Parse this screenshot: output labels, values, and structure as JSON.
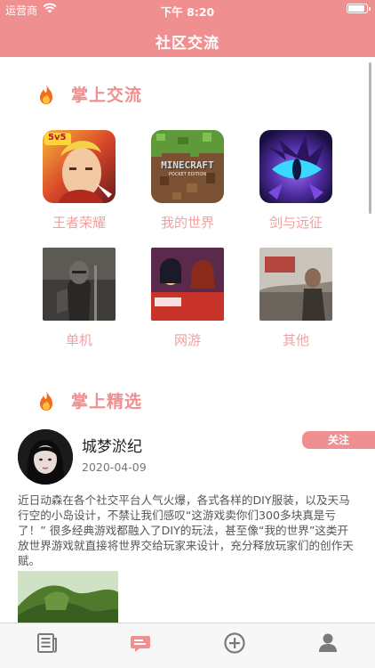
{
  "status_bar": {
    "carrier": "运营商",
    "time": "下午 8:20"
  },
  "nav": {
    "title": "社区交流"
  },
  "sections": {
    "exchange": {
      "title": "掌上交流",
      "icon": "flame-icon"
    },
    "featured": {
      "title": "掌上精选",
      "icon": "flame-icon"
    }
  },
  "categories": [
    {
      "label": "王者荣耀",
      "badge": "5v5"
    },
    {
      "label": "我的世界",
      "logo": "MINECRAFT",
      "logo_sub": "POCKET EDITION"
    },
    {
      "label": "剑与远征"
    },
    {
      "label": "单机"
    },
    {
      "label": "网游"
    },
    {
      "label": "其他"
    }
  ],
  "post": {
    "author": "城梦淤纪",
    "date": "2020-04-09",
    "follow_label": "关注",
    "text": "近日动森在各个社交平台人气火爆，各式各样的DIY服装，以及天马行空的小岛设计，不禁让我们感叹“这游戏卖你们300多块真是亏了！” 很多经典游戏都融入了DIY的玩法，甚至像“我的世界”这类开放世界游戏就直接将世界交给玩家来设计，充分释放玩家们的创作天赋。"
  },
  "tabbar": {
    "items": [
      {
        "icon": "news-icon",
        "active": false
      },
      {
        "icon": "chat-icon",
        "active": true
      },
      {
        "icon": "add-circle-icon",
        "active": false
      },
      {
        "icon": "user-icon",
        "active": false
      }
    ]
  },
  "colors": {
    "accent": "#f08f8f",
    "label": "#f2a0a0",
    "tab_inactive": "#7a7a7a"
  }
}
